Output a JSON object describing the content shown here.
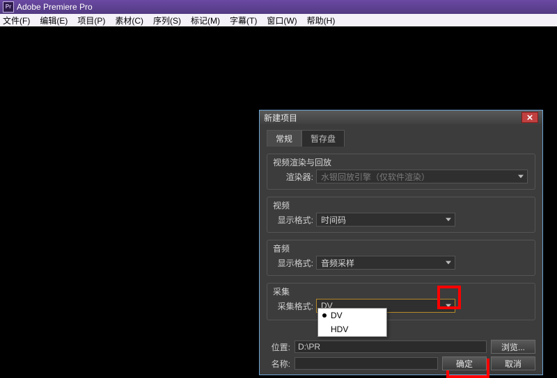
{
  "app": {
    "title": "Adobe Premiere Pro",
    "icon_text": "Pr"
  },
  "menu": {
    "file": "文件(F)",
    "edit": "编辑(E)",
    "project": "项目(P)",
    "clip": "素材(C)",
    "sequence": "序列(S)",
    "marker": "标记(M)",
    "title": "字幕(T)",
    "window": "窗口(W)",
    "help": "帮助(H)"
  },
  "dialog": {
    "title": "新建项目",
    "tabs": {
      "general": "常规",
      "scratch": "暂存盘"
    },
    "groups": {
      "render": {
        "title": "视频渲染与回放",
        "renderer_label": "渲染器:",
        "renderer_value": "水银回放引擎（仅软件渲染）"
      },
      "video": {
        "title": "视频",
        "display_format_label": "显示格式:",
        "display_format_value": "时间码"
      },
      "audio": {
        "title": "音频",
        "display_format_label": "显示格式:",
        "display_format_value": "音频采样"
      },
      "capture": {
        "title": "采集",
        "capture_format_label": "采集格式:",
        "capture_format_value": "DV",
        "options": [
          "DV",
          "HDV"
        ]
      }
    },
    "location": {
      "label": "位置:",
      "value": "D:\\PR",
      "browse": "浏览..."
    },
    "name": {
      "label": "名称:",
      "value": ""
    },
    "buttons": {
      "ok": "确定",
      "cancel": "取消"
    }
  }
}
